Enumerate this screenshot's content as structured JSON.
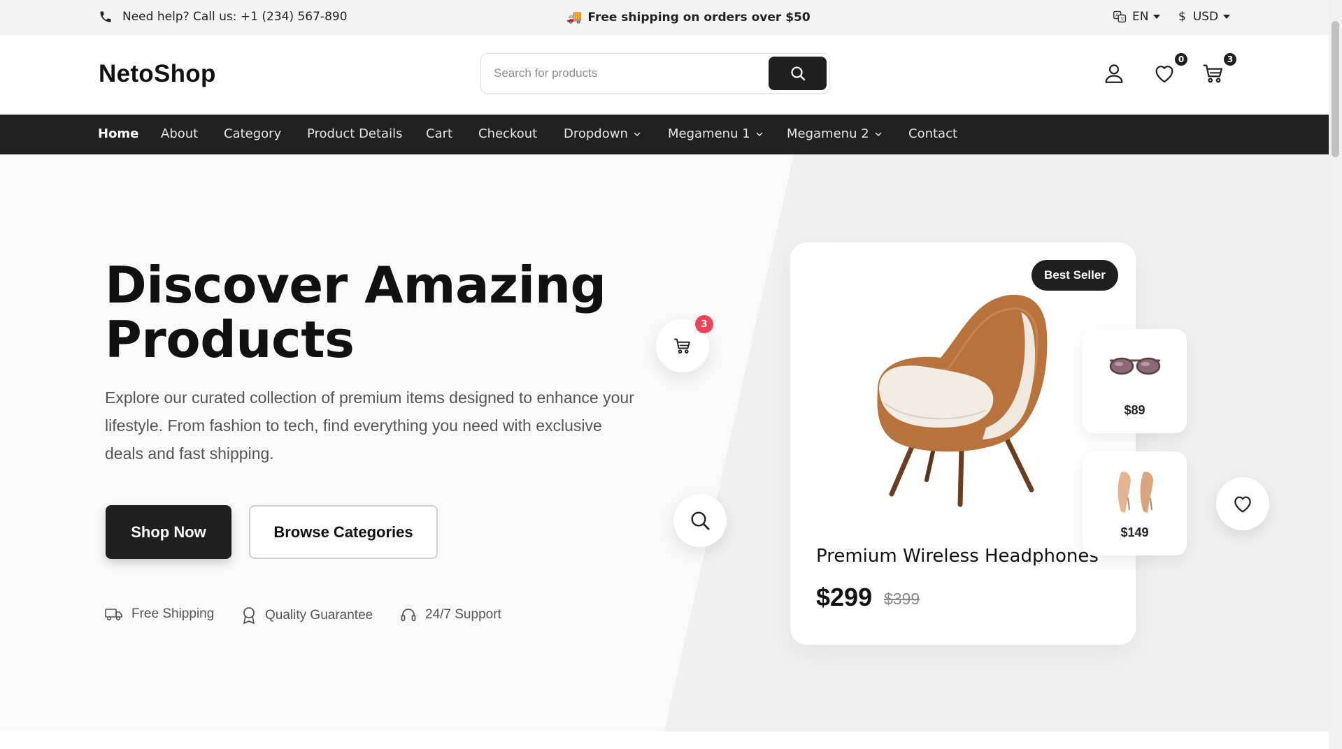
{
  "topbar": {
    "help_text": "Need help? Call us: +1 (234) 567-890",
    "promo_text": "Free shipping on orders over $50",
    "language": "EN",
    "currency_symbol": "$",
    "currency": "USD"
  },
  "header": {
    "logo": "NetoShop",
    "search_placeholder": "Search for products",
    "wishlist_count": "0",
    "cart_count": "3"
  },
  "nav": {
    "items": [
      {
        "label": "Home",
        "active": true
      },
      {
        "label": "About"
      },
      {
        "label": "Category"
      },
      {
        "label": "Product Details"
      },
      {
        "label": "Cart"
      },
      {
        "label": "Checkout"
      },
      {
        "label": "Dropdown",
        "has_dropdown": true
      },
      {
        "label": "Megamenu 1",
        "has_dropdown": true
      },
      {
        "label": "Megamenu 2",
        "has_dropdown": true
      },
      {
        "label": "Contact"
      }
    ]
  },
  "hero": {
    "title_line1": "Discover Amazing",
    "title_line2": "Products",
    "description": "Explore our curated collection of premium items designed to enhance your lifestyle. From fashion to tech, find everything you need with exclusive deals and fast shipping.",
    "primary_button": "Shop Now",
    "secondary_button": "Browse Categories",
    "features": [
      "Free Shipping",
      "Quality Guarantee",
      "24/7 Support"
    ],
    "floating_cart_count": "3"
  },
  "product_card": {
    "badge": "Best Seller",
    "name": "Premium Wireless Headphones",
    "price": "$299",
    "old_price": "$399"
  },
  "mini_products": [
    {
      "price": "$89",
      "icon": "sunglasses-icon"
    },
    {
      "price": "$149",
      "icon": "heels-icon"
    }
  ],
  "colors": {
    "dark": "#1f1f1f",
    "accent_red": "#ee4457",
    "background": "#fafafa"
  }
}
